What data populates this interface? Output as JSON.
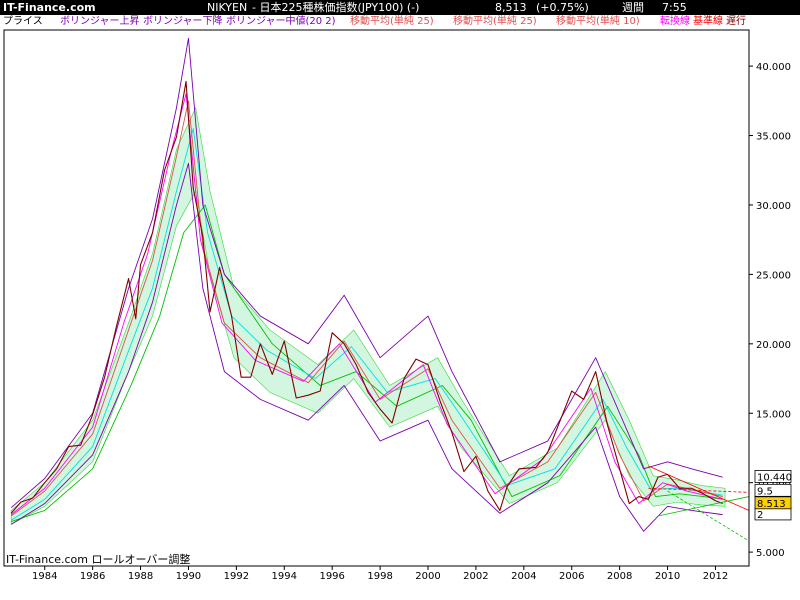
{
  "window": {
    "site": "IT-Finance.com",
    "ticker": "NIKYEN",
    "title": "- 日本225種株価指数(JPY100)  (-)",
    "price": "8,513",
    "change": "(+0.75%)",
    "period": "週間",
    "time": "7:55"
  },
  "legend": [
    {
      "label": "プライス",
      "color": "#000000"
    },
    {
      "label": "ボリンジャー上昇",
      "color": "#7b00b0"
    },
    {
      "label": "ボリンジャー下降",
      "color": "#7b00b0"
    },
    {
      "label": "ボリンジャー中値(20 2)",
      "color": "#7b00b0"
    },
    {
      "label": "移動平均(単純 25)",
      "color": "#e05050"
    },
    {
      "label": "移動平均(単純 25)",
      "color": "#e05050"
    },
    {
      "label": "移動平均(単純 10)",
      "color": "#e05050"
    },
    {
      "label": "転換線",
      "color": "#ff00ff"
    },
    {
      "label": "基準線",
      "color": "#ff0000"
    },
    {
      "label": "遅行",
      "color": "#800000"
    }
  ],
  "footer": "IT-Finance.com ロールオーバー調整",
  "price_badges": {
    "upper": "10.440",
    "middle": "8.513",
    "mid2": "9.5",
    "lower": "2"
  },
  "chart_data": {
    "type": "line",
    "title": "",
    "xlabel": "",
    "ylabel": "",
    "xlim": [
      1982.3,
      2013.4
    ],
    "ylim": [
      4.0,
      42.6
    ],
    "x_ticks": [
      1984,
      1986,
      1988,
      1990,
      1992,
      1994,
      1996,
      1998,
      2000,
      2002,
      2004,
      2006,
      2008,
      2010,
      2012
    ],
    "y_ticks": [
      {
        "value": 5,
        "label": "5.000"
      },
      {
        "value": 10,
        "label": "10.000"
      },
      {
        "value": 15,
        "label": "15.000"
      },
      {
        "value": 20,
        "label": "20.000"
      },
      {
        "value": 25,
        "label": "25.000"
      },
      {
        "value": 30,
        "label": "30.000"
      },
      {
        "value": 35,
        "label": "35.000"
      },
      {
        "value": 40,
        "label": "40.000"
      }
    ],
    "grid": false,
    "series": [
      {
        "name": "プライス",
        "color": "#800000",
        "x": [
          1982.6,
          1983,
          1983.5,
          1984,
          1984.5,
          1985,
          1985.5,
          1986,
          1986.5,
          1987,
          1987.5,
          1987.8,
          1988,
          1988.5,
          1989,
          1989.5,
          1989.9,
          1990.2,
          1990.6,
          1990.9,
          1991.3,
          1991.8,
          1992.2,
          1992.6,
          1993,
          1993.5,
          1994,
          1994.5,
          1995,
          1995.5,
          1996,
          1996.5,
          1997,
          1997.5,
          1998,
          1998.5,
          1999,
          1999.5,
          2000,
          2000.5,
          2001,
          2001.5,
          2002,
          2002.5,
          2003,
          2003.3,
          2003.8,
          2004.5,
          2005,
          2005.5,
          2006,
          2006.5,
          2007,
          2007.5,
          2008,
          2008.4,
          2008.8,
          2009.2,
          2009.6,
          2010,
          2010.5,
          2011,
          2011.5,
          2012,
          2012.3
        ],
        "y": [
          7.8,
          8.6,
          8.9,
          10.0,
          11.0,
          12.6,
          12.7,
          14.9,
          17.6,
          21.3,
          24.7,
          21.8,
          25.7,
          28.0,
          32.5,
          34.9,
          38.9,
          31.2,
          27.7,
          22.3,
          25.5,
          22.0,
          17.6,
          17.6,
          20.0,
          17.8,
          20.2,
          16.1,
          16.3,
          16.6,
          20.8,
          20.0,
          18.5,
          16.5,
          15.3,
          14.3,
          17.5,
          18.9,
          18.5,
          15.9,
          13.6,
          10.8,
          11.9,
          9.4,
          8.0,
          9.7,
          11.0,
          11.1,
          12.2,
          14.4,
          16.6,
          16.0,
          18.0,
          14.1,
          11.0,
          8.5,
          9.0,
          8.8,
          10.4,
          10.6,
          9.6,
          9.6,
          9.2,
          8.7,
          8.5
        ]
      },
      {
        "name": "ボリンジャー上昇",
        "color": "#7b00b0",
        "x": [
          1982.6,
          1984,
          1986,
          1987.5,
          1988.5,
          1989.5,
          1990,
          1990.6,
          1991.5,
          1993,
          1995,
          1996.5,
          1998,
          2000,
          2001,
          2003,
          2005,
          2007,
          2008,
          2009,
          2010,
          2011,
          2012.3
        ],
        "y": [
          8.2,
          10.3,
          15.0,
          24.0,
          29.0,
          37.0,
          42.0,
          30.0,
          25.0,
          22.0,
          20.0,
          23.5,
          19.0,
          22.0,
          18.0,
          11.5,
          13.0,
          19.0,
          15.0,
          11.0,
          11.5,
          11.0,
          10.4
        ]
      },
      {
        "name": "ボリンジャー下降",
        "color": "#7b00b0",
        "x": [
          1982.6,
          1984,
          1986,
          1987.5,
          1988.5,
          1989.5,
          1990,
          1990.6,
          1991.5,
          1993,
          1995,
          1996.5,
          1998,
          2000,
          2001,
          2003,
          2005,
          2007,
          2008,
          2009,
          2010,
          2011,
          2012.3
        ],
        "y": [
          7.0,
          8.5,
          12.0,
          18.0,
          23.0,
          30.0,
          33.0,
          24.0,
          18.0,
          16.0,
          14.5,
          17.0,
          13.0,
          14.5,
          11.0,
          7.8,
          10.0,
          14.0,
          9.0,
          6.5,
          8.3,
          8.0,
          7.7
        ]
      },
      {
        "name": "移動平均(単純 25)",
        "color": "#e05050",
        "x": [
          1982.6,
          1984,
          1986,
          1987.5,
          1988.5,
          1989.5,
          1990,
          1990.6,
          1991.5,
          1993,
          1995,
          1996.5,
          1998,
          2000,
          2001,
          2003,
          2005,
          2007,
          2008,
          2009,
          2010,
          2011,
          2012.3
        ],
        "y": [
          7.6,
          9.4,
          13.5,
          21.0,
          26.0,
          33.5,
          37.5,
          27.0,
          21.5,
          19.0,
          17.2,
          20.2,
          16.0,
          18.2,
          14.5,
          9.6,
          11.5,
          16.5,
          12.0,
          8.7,
          9.9,
          9.5,
          9.0
        ]
      },
      {
        "name": "転換線",
        "color": "#ff00ff",
        "x": [
          1982.6,
          1984,
          1986,
          1987.3,
          1988.3,
          1989.3,
          1989.9,
          1990.5,
          1991.4,
          1992.8,
          1994.8,
          1996.3,
          1997.8,
          1999.8,
          2000.8,
          2002.8,
          2004.8,
          2006.8,
          2007.8,
          2008.8,
          2009.8,
          2010.8,
          2012.3
        ],
        "y": [
          7.7,
          9.6,
          14.0,
          21.5,
          26.5,
          34.0,
          38.0,
          27.5,
          21.5,
          18.8,
          17.3,
          20.0,
          15.8,
          18.5,
          14.2,
          9.2,
          11.7,
          16.8,
          11.5,
          8.5,
          10.0,
          9.4,
          8.8
        ]
      },
      {
        "name": "移動平均(単純 10)",
        "color": "#00e0e0",
        "x": [
          1982.6,
          1984,
          1986,
          1987.5,
          1988.5,
          1989.5,
          1990.2,
          1990.8,
          1991.8,
          1993.3,
          1995.3,
          1996.8,
          1998.3,
          2000.3,
          2001.3,
          2003.3,
          2005.3,
          2007.3,
          2008.3,
          2009.3,
          2010.3,
          2011.3,
          2012.3
        ],
        "y": [
          7.3,
          8.8,
          12.6,
          19.5,
          24.0,
          31.0,
          35.5,
          28.0,
          22.0,
          19.5,
          17.5,
          19.8,
          16.5,
          17.5,
          15.0,
          9.8,
          11.0,
          16.0,
          12.5,
          9.5,
          9.6,
          9.4,
          9.1
        ]
      },
      {
        "name": "基準線",
        "color": "#00c000",
        "x": [
          1982.6,
          1984,
          1986,
          1987.6,
          1988.8,
          1989.8,
          1990.7,
          1991.5,
          1993.5,
          1995.5,
          1997,
          1998.7,
          2000.6,
          2001.8,
          2003.5,
          2005.5,
          2007.5,
          2008.8,
          2009.5,
          2010.5,
          2011.5,
          2012.3
        ],
        "y": [
          7.2,
          8.0,
          11.0,
          17.0,
          22.0,
          28.0,
          30.0,
          25.0,
          20.0,
          17.0,
          18.0,
          15.5,
          17.0,
          14.5,
          9.0,
          10.5,
          15.5,
          12.0,
          9.0,
          9.2,
          9.0,
          8.8
        ]
      }
    ],
    "cloud": {
      "color": "#c8f5d8",
      "top": [
        8.0,
        10.0,
        14.5,
        21.5,
        26.5,
        34.0,
        37.0,
        31.0,
        24.0,
        21.0,
        18.5,
        21.0,
        17.0,
        19.0,
        16.0,
        10.5,
        12.5,
        18.0,
        14.5,
        10.5,
        10.2,
        9.8,
        9.6
      ],
      "bottom": [
        7.0,
        8.3,
        11.5,
        18.0,
        22.0,
        28.5,
        31.0,
        25.0,
        19.0,
        16.5,
        15.0,
        17.5,
        14.0,
        15.5,
        12.5,
        8.5,
        10.0,
        14.5,
        10.5,
        8.3,
        8.6,
        8.4,
        8.3
      ],
      "x": [
        1982.6,
        1984,
        1986,
        1987.5,
        1988.5,
        1989.5,
        1990.3,
        1990.9,
        1991.9,
        1993.4,
        1995.4,
        1996.9,
        1998.4,
        2000.4,
        2001.4,
        2003.4,
        2005.4,
        2007.4,
        2008.4,
        2009.4,
        2010.4,
        2011.4,
        2012.4
      ]
    },
    "trendlines": [
      {
        "color": "#ff0000",
        "x": [
          2009.2,
          2013.4
        ],
        "y": [
          11.2,
          8.0
        ]
      },
      {
        "color": "#ff0000",
        "x": [
          2009.2,
          2013.4
        ],
        "y": [
          9.6,
          9.3
        ]
      },
      {
        "color": "#00c000",
        "x": [
          2009.6,
          2013.4
        ],
        "y": [
          7.6,
          9.0
        ]
      },
      {
        "color": "#00c000",
        "x": [
          2010.0,
          2013.4
        ],
        "y": [
          9.4,
          5.8
        ]
      }
    ]
  }
}
